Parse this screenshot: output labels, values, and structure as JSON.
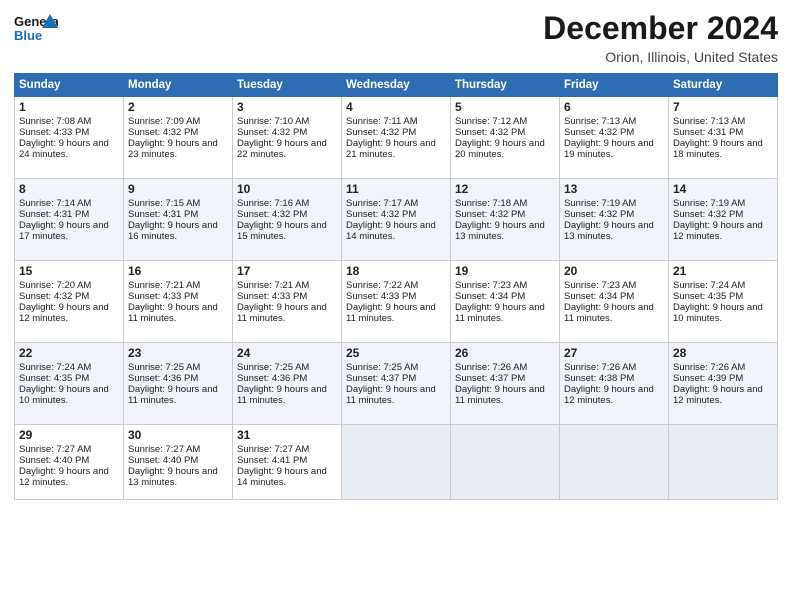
{
  "header": {
    "logo_general": "General",
    "logo_blue": "Blue",
    "month_title": "December 2024",
    "location": "Orion, Illinois, United States"
  },
  "days_of_week": [
    "Sunday",
    "Monday",
    "Tuesday",
    "Wednesday",
    "Thursday",
    "Friday",
    "Saturday"
  ],
  "weeks": [
    [
      {
        "day": 1,
        "sunrise": "Sunrise: 7:08 AM",
        "sunset": "Sunset: 4:33 PM",
        "daylight": "Daylight: 9 hours and 24 minutes."
      },
      {
        "day": 2,
        "sunrise": "Sunrise: 7:09 AM",
        "sunset": "Sunset: 4:32 PM",
        "daylight": "Daylight: 9 hours and 23 minutes."
      },
      {
        "day": 3,
        "sunrise": "Sunrise: 7:10 AM",
        "sunset": "Sunset: 4:32 PM",
        "daylight": "Daylight: 9 hours and 22 minutes."
      },
      {
        "day": 4,
        "sunrise": "Sunrise: 7:11 AM",
        "sunset": "Sunset: 4:32 PM",
        "daylight": "Daylight: 9 hours and 21 minutes."
      },
      {
        "day": 5,
        "sunrise": "Sunrise: 7:12 AM",
        "sunset": "Sunset: 4:32 PM",
        "daylight": "Daylight: 9 hours and 20 minutes."
      },
      {
        "day": 6,
        "sunrise": "Sunrise: 7:13 AM",
        "sunset": "Sunset: 4:32 PM",
        "daylight": "Daylight: 9 hours and 19 minutes."
      },
      {
        "day": 7,
        "sunrise": "Sunrise: 7:13 AM",
        "sunset": "Sunset: 4:31 PM",
        "daylight": "Daylight: 9 hours and 18 minutes."
      }
    ],
    [
      {
        "day": 8,
        "sunrise": "Sunrise: 7:14 AM",
        "sunset": "Sunset: 4:31 PM",
        "daylight": "Daylight: 9 hours and 17 minutes."
      },
      {
        "day": 9,
        "sunrise": "Sunrise: 7:15 AM",
        "sunset": "Sunset: 4:31 PM",
        "daylight": "Daylight: 9 hours and 16 minutes."
      },
      {
        "day": 10,
        "sunrise": "Sunrise: 7:16 AM",
        "sunset": "Sunset: 4:32 PM",
        "daylight": "Daylight: 9 hours and 15 minutes."
      },
      {
        "day": 11,
        "sunrise": "Sunrise: 7:17 AM",
        "sunset": "Sunset: 4:32 PM",
        "daylight": "Daylight: 9 hours and 14 minutes."
      },
      {
        "day": 12,
        "sunrise": "Sunrise: 7:18 AM",
        "sunset": "Sunset: 4:32 PM",
        "daylight": "Daylight: 9 hours and 13 minutes."
      },
      {
        "day": 13,
        "sunrise": "Sunrise: 7:19 AM",
        "sunset": "Sunset: 4:32 PM",
        "daylight": "Daylight: 9 hours and 13 minutes."
      },
      {
        "day": 14,
        "sunrise": "Sunrise: 7:19 AM",
        "sunset": "Sunset: 4:32 PM",
        "daylight": "Daylight: 9 hours and 12 minutes."
      }
    ],
    [
      {
        "day": 15,
        "sunrise": "Sunrise: 7:20 AM",
        "sunset": "Sunset: 4:32 PM",
        "daylight": "Daylight: 9 hours and 12 minutes."
      },
      {
        "day": 16,
        "sunrise": "Sunrise: 7:21 AM",
        "sunset": "Sunset: 4:33 PM",
        "daylight": "Daylight: 9 hours and 11 minutes."
      },
      {
        "day": 17,
        "sunrise": "Sunrise: 7:21 AM",
        "sunset": "Sunset: 4:33 PM",
        "daylight": "Daylight: 9 hours and 11 minutes."
      },
      {
        "day": 18,
        "sunrise": "Sunrise: 7:22 AM",
        "sunset": "Sunset: 4:33 PM",
        "daylight": "Daylight: 9 hours and 11 minutes."
      },
      {
        "day": 19,
        "sunrise": "Sunrise: 7:23 AM",
        "sunset": "Sunset: 4:34 PM",
        "daylight": "Daylight: 9 hours and 11 minutes."
      },
      {
        "day": 20,
        "sunrise": "Sunrise: 7:23 AM",
        "sunset": "Sunset: 4:34 PM",
        "daylight": "Daylight: 9 hours and 11 minutes."
      },
      {
        "day": 21,
        "sunrise": "Sunrise: 7:24 AM",
        "sunset": "Sunset: 4:35 PM",
        "daylight": "Daylight: 9 hours and 10 minutes."
      }
    ],
    [
      {
        "day": 22,
        "sunrise": "Sunrise: 7:24 AM",
        "sunset": "Sunset: 4:35 PM",
        "daylight": "Daylight: 9 hours and 10 minutes."
      },
      {
        "day": 23,
        "sunrise": "Sunrise: 7:25 AM",
        "sunset": "Sunset: 4:36 PM",
        "daylight": "Daylight: 9 hours and 11 minutes."
      },
      {
        "day": 24,
        "sunrise": "Sunrise: 7:25 AM",
        "sunset": "Sunset: 4:36 PM",
        "daylight": "Daylight: 9 hours and 11 minutes."
      },
      {
        "day": 25,
        "sunrise": "Sunrise: 7:25 AM",
        "sunset": "Sunset: 4:37 PM",
        "daylight": "Daylight: 9 hours and 11 minutes."
      },
      {
        "day": 26,
        "sunrise": "Sunrise: 7:26 AM",
        "sunset": "Sunset: 4:37 PM",
        "daylight": "Daylight: 9 hours and 11 minutes."
      },
      {
        "day": 27,
        "sunrise": "Sunrise: 7:26 AM",
        "sunset": "Sunset: 4:38 PM",
        "daylight": "Daylight: 9 hours and 12 minutes."
      },
      {
        "day": 28,
        "sunrise": "Sunrise: 7:26 AM",
        "sunset": "Sunset: 4:39 PM",
        "daylight": "Daylight: 9 hours and 12 minutes."
      }
    ],
    [
      {
        "day": 29,
        "sunrise": "Sunrise: 7:27 AM",
        "sunset": "Sunset: 4:40 PM",
        "daylight": "Daylight: 9 hours and 12 minutes."
      },
      {
        "day": 30,
        "sunrise": "Sunrise: 7:27 AM",
        "sunset": "Sunset: 4:40 PM",
        "daylight": "Daylight: 9 hours and 13 minutes."
      },
      {
        "day": 31,
        "sunrise": "Sunrise: 7:27 AM",
        "sunset": "Sunset: 4:41 PM",
        "daylight": "Daylight: 9 hours and 14 minutes."
      },
      null,
      null,
      null,
      null
    ]
  ]
}
